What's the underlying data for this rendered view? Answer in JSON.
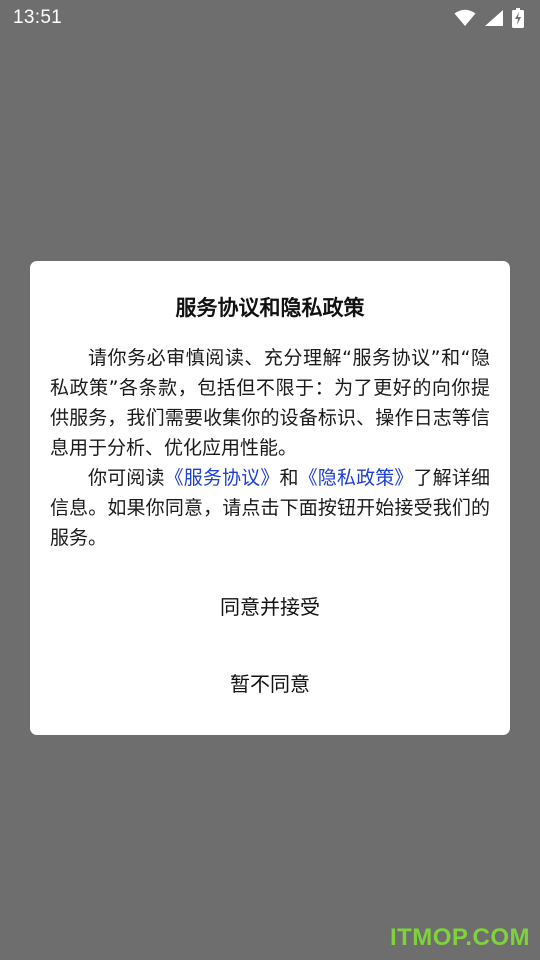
{
  "status_bar": {
    "time": "13:51",
    "icons": [
      "wifi-icon",
      "signal-icon",
      "battery-charging-icon"
    ]
  },
  "dialog": {
    "title": "服务协议和隐私政策",
    "paragraph1": "请你务必审慎阅读、充分理解“服务协议”和“隐私政策”各条款，包括但不限于：为了更好的向你提供服务，我们需要收集你的设备标识、操作日志等信息用于分析、优化应用性能。",
    "paragraph2": {
      "prefix": "你可阅读",
      "link_service": "《服务协议》",
      "middle": "和",
      "link_privacy": "《隐私政策》",
      "suffix": "了解详细信息。如果你同意，请点击下面按钮开始接受我们的服务。"
    },
    "agree_label": "同意并接受",
    "decline_label": "暂不同意"
  },
  "watermark": "ITMOP.COM",
  "colors": {
    "backdrop": "#6e6e6e",
    "dialog_bg": "#ffffff",
    "link": "#1e3fd6",
    "watermark": "#7fd23c"
  }
}
